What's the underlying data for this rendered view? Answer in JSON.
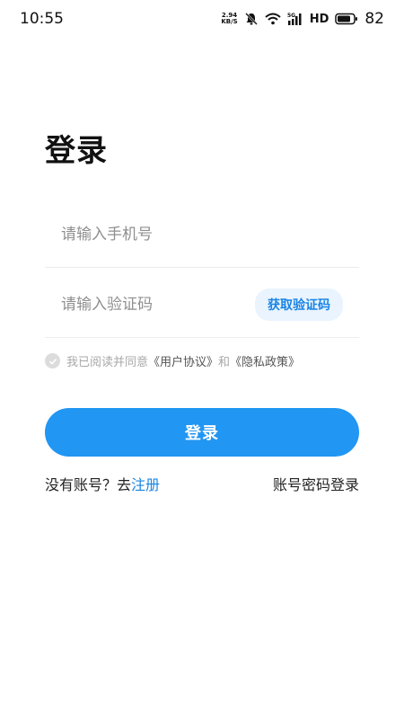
{
  "status_bar": {
    "time": "10:55",
    "net_speed_value": "2.94",
    "net_speed_unit": "KB/S",
    "network_type": "5G",
    "hd_label": "HD",
    "battery_level": "82"
  },
  "page": {
    "title": "登录"
  },
  "form": {
    "phone_placeholder": "请输入手机号",
    "code_placeholder": "请输入验证码",
    "get_code_label": "获取验证码"
  },
  "agreement": {
    "prefix": "我已阅读并同意",
    "user_agreement": "《用户协议》",
    "and": "和",
    "privacy_policy": "《隐私政策》"
  },
  "actions": {
    "login_label": "登录",
    "no_account_prefix": "没有账号？去",
    "register_label": "注册",
    "password_login_label": "账号密码登录"
  },
  "colors": {
    "primary": "#2196f3",
    "link": "#1a84e4",
    "code_button_bg": "#e9f4fe"
  }
}
